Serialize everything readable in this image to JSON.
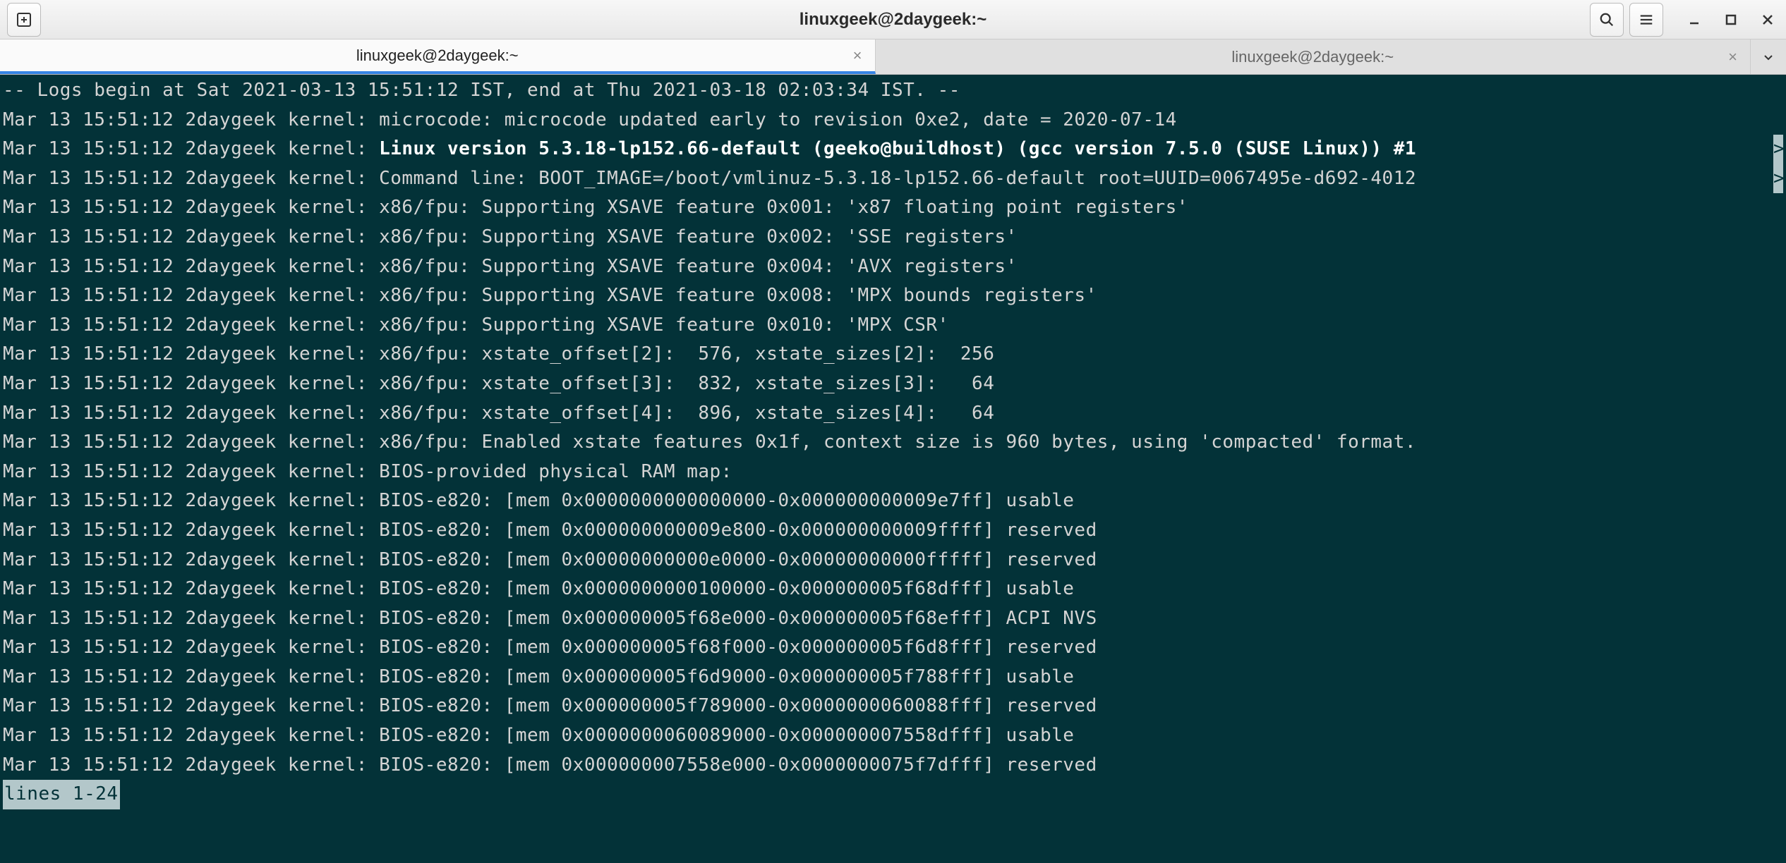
{
  "window": {
    "title": "linuxgeek@2daygeek:~"
  },
  "tabs": [
    {
      "label": "linuxgeek@2daygeek:~",
      "active": true
    },
    {
      "label": "linuxgeek@2daygeek:~",
      "active": false
    }
  ],
  "terminal": {
    "status_line": "lines 1-24",
    "log_header": "-- Logs begin at Sat 2021-03-13 15:51:12 IST, end at Thu 2021-03-18 02:03:34 IST. --",
    "lines": [
      {
        "prefix": "Mar 13 15:51:12 2daygeek kernel: ",
        "text": "microcode: microcode updated early to revision 0xe2, date = 2020-07-14",
        "bold": false
      },
      {
        "prefix": "Mar 13 15:51:12 2daygeek kernel: ",
        "text": "Linux version 5.3.18-lp152.66-default (geeko@buildhost) (gcc version 7.5.0 (SUSE Linux)) #1",
        "bold": true,
        "scroll": ">"
      },
      {
        "prefix": "Mar 13 15:51:12 2daygeek kernel: ",
        "text": "Command line: BOOT_IMAGE=/boot/vmlinuz-5.3.18-lp152.66-default root=UUID=0067495e-d692-4012",
        "bold": false,
        "scroll": ">"
      },
      {
        "prefix": "Mar 13 15:51:12 2daygeek kernel: ",
        "text": "x86/fpu: Supporting XSAVE feature 0x001: 'x87 floating point registers'",
        "bold": false
      },
      {
        "prefix": "Mar 13 15:51:12 2daygeek kernel: ",
        "text": "x86/fpu: Supporting XSAVE feature 0x002: 'SSE registers'",
        "bold": false
      },
      {
        "prefix": "Mar 13 15:51:12 2daygeek kernel: ",
        "text": "x86/fpu: Supporting XSAVE feature 0x004: 'AVX registers'",
        "bold": false
      },
      {
        "prefix": "Mar 13 15:51:12 2daygeek kernel: ",
        "text": "x86/fpu: Supporting XSAVE feature 0x008: 'MPX bounds registers'",
        "bold": false
      },
      {
        "prefix": "Mar 13 15:51:12 2daygeek kernel: ",
        "text": "x86/fpu: Supporting XSAVE feature 0x010: 'MPX CSR'",
        "bold": false
      },
      {
        "prefix": "Mar 13 15:51:12 2daygeek kernel: ",
        "text": "x86/fpu: xstate_offset[2]:  576, xstate_sizes[2]:  256",
        "bold": false
      },
      {
        "prefix": "Mar 13 15:51:12 2daygeek kernel: ",
        "text": "x86/fpu: xstate_offset[3]:  832, xstate_sizes[3]:   64",
        "bold": false
      },
      {
        "prefix": "Mar 13 15:51:12 2daygeek kernel: ",
        "text": "x86/fpu: xstate_offset[4]:  896, xstate_sizes[4]:   64",
        "bold": false
      },
      {
        "prefix": "Mar 13 15:51:12 2daygeek kernel: ",
        "text": "x86/fpu: Enabled xstate features 0x1f, context size is 960 bytes, using 'compacted' format.",
        "bold": false
      },
      {
        "prefix": "Mar 13 15:51:12 2daygeek kernel: ",
        "text": "BIOS-provided physical RAM map:",
        "bold": false
      },
      {
        "prefix": "Mar 13 15:51:12 2daygeek kernel: ",
        "text": "BIOS-e820: [mem 0x0000000000000000-0x000000000009e7ff] usable",
        "bold": false
      },
      {
        "prefix": "Mar 13 15:51:12 2daygeek kernel: ",
        "text": "BIOS-e820: [mem 0x000000000009e800-0x000000000009ffff] reserved",
        "bold": false
      },
      {
        "prefix": "Mar 13 15:51:12 2daygeek kernel: ",
        "text": "BIOS-e820: [mem 0x00000000000e0000-0x00000000000fffff] reserved",
        "bold": false
      },
      {
        "prefix": "Mar 13 15:51:12 2daygeek kernel: ",
        "text": "BIOS-e820: [mem 0x0000000000100000-0x000000005f68dfff] usable",
        "bold": false
      },
      {
        "prefix": "Mar 13 15:51:12 2daygeek kernel: ",
        "text": "BIOS-e820: [mem 0x000000005f68e000-0x000000005f68efff] ACPI NVS",
        "bold": false
      },
      {
        "prefix": "Mar 13 15:51:12 2daygeek kernel: ",
        "text": "BIOS-e820: [mem 0x000000005f68f000-0x000000005f6d8fff] reserved",
        "bold": false
      },
      {
        "prefix": "Mar 13 15:51:12 2daygeek kernel: ",
        "text": "BIOS-e820: [mem 0x000000005f6d9000-0x000000005f788fff] usable",
        "bold": false
      },
      {
        "prefix": "Mar 13 15:51:12 2daygeek kernel: ",
        "text": "BIOS-e820: [mem 0x000000005f789000-0x0000000060088fff] reserved",
        "bold": false
      },
      {
        "prefix": "Mar 13 15:51:12 2daygeek kernel: ",
        "text": "BIOS-e820: [mem 0x0000000060089000-0x000000007558dfff] usable",
        "bold": false
      },
      {
        "prefix": "Mar 13 15:51:12 2daygeek kernel: ",
        "text": "BIOS-e820: [mem 0x000000007558e000-0x0000000075f7dfff] reserved",
        "bold": false
      }
    ]
  }
}
